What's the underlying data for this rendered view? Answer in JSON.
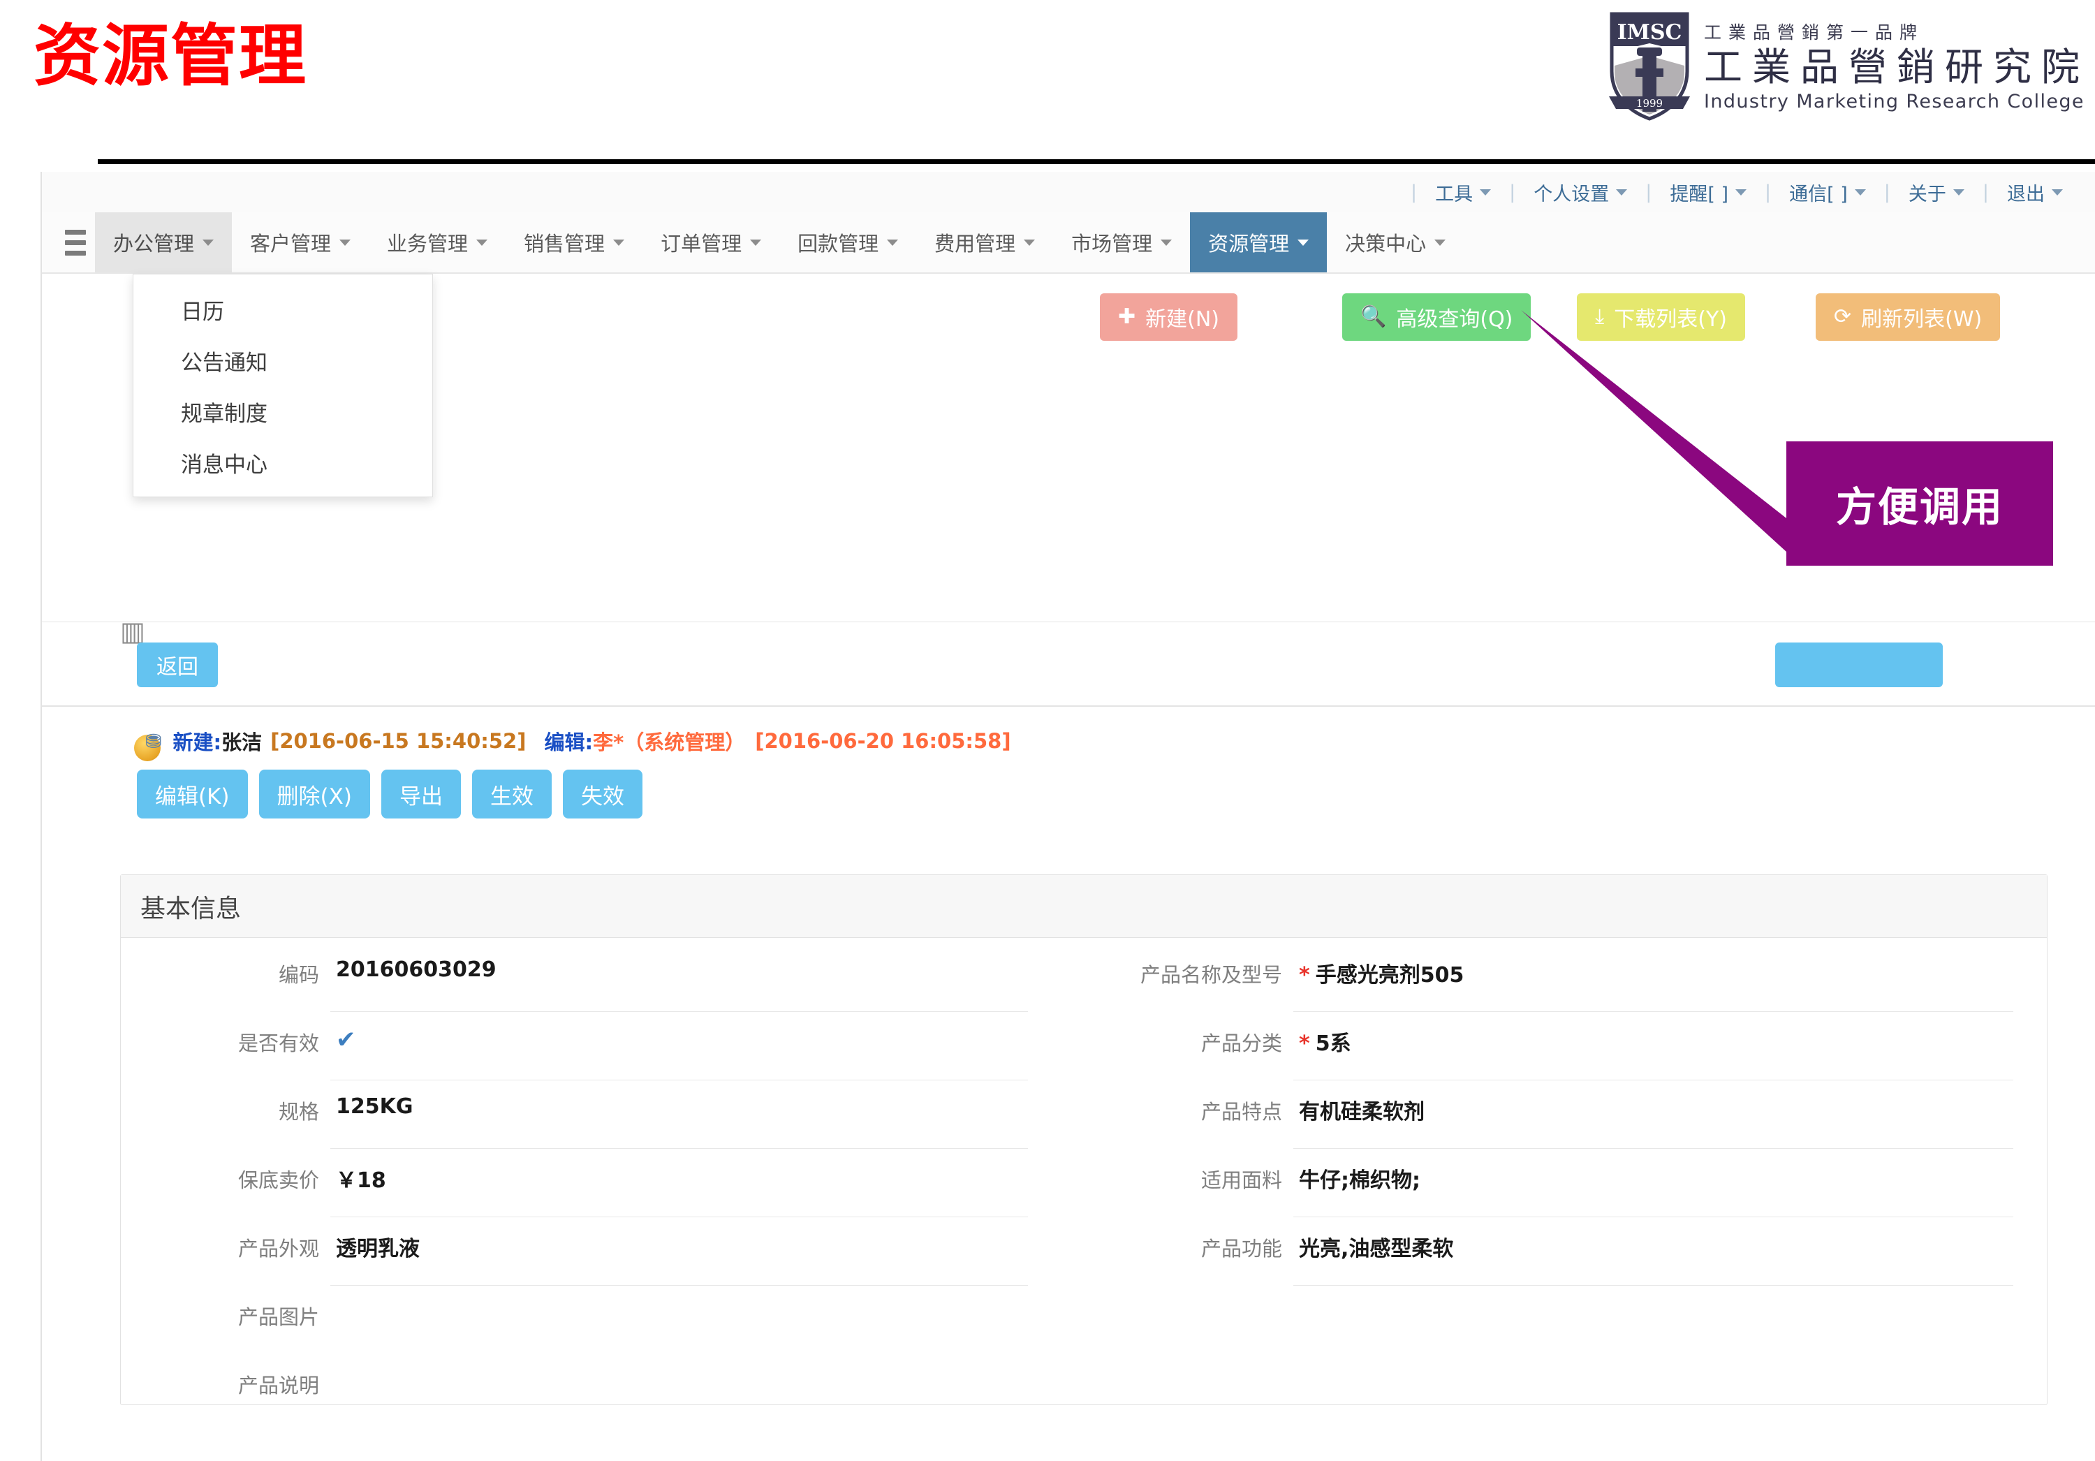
{
  "slide": {
    "title": "资源管理",
    "callout": "方便调用"
  },
  "logo": {
    "shield_text": "IMSC",
    "shield_year": "1999",
    "tagline": "工業品營銷第一品牌",
    "name_cn": "工業品營銷研究院",
    "name_en": "Industry Marketing Research College"
  },
  "utility_bar": {
    "items": [
      {
        "label": "工具",
        "icon": "chevron-down-icon"
      },
      {
        "label": "个人设置",
        "icon": "chevron-down-icon"
      },
      {
        "label": "提醒[ ]",
        "icon": "chevron-down-icon"
      },
      {
        "label": "通信[ ]",
        "icon": "chevron-down-icon"
      },
      {
        "label": "关于",
        "icon": "chevron-down-icon"
      },
      {
        "label": "退出",
        "icon": "chevron-down-icon"
      }
    ]
  },
  "main_nav": {
    "menu_icon": "hamburger-icon",
    "items": [
      {
        "label": "办公管理",
        "state": "open"
      },
      {
        "label": "客户管理",
        "state": "normal"
      },
      {
        "label": "业务管理",
        "state": "normal"
      },
      {
        "label": "销售管理",
        "state": "normal"
      },
      {
        "label": "订单管理",
        "state": "normal"
      },
      {
        "label": "回款管理",
        "state": "normal"
      },
      {
        "label": "费用管理",
        "state": "normal"
      },
      {
        "label": "市场管理",
        "state": "normal"
      },
      {
        "label": "资源管理",
        "state": "active"
      },
      {
        "label": "决策中心",
        "state": "normal"
      }
    ]
  },
  "dropdown": {
    "parent": "办公管理",
    "items": [
      {
        "label": "日历"
      },
      {
        "label": "公告通知"
      },
      {
        "label": "规章制度"
      },
      {
        "label": "消息中心"
      }
    ]
  },
  "toolbar": {
    "new_icon": "plus-icon",
    "new_label": "新建(N)",
    "query_icon": "search-icon",
    "query_label": "高级查询(Q)",
    "download_icon": "download-icon",
    "download_label": "下载列表(Y)",
    "refresh_icon": "refresh-icon",
    "refresh_label": "刷新列表(W)",
    "colors": {
      "new": "#f2a49b",
      "query": "#6ed77f",
      "download": "#e5e86e",
      "refresh": "#f2bd79"
    }
  },
  "record_bar": {
    "back_label": "返回",
    "top_right_label": ""
  },
  "audit": {
    "icon": "record-icon",
    "create_label": "新建:",
    "create_user": "张洁",
    "create_date": "[2016-06-15 15:40:52]",
    "edit_label": "编辑:",
    "edit_user": "李*（系统管理）",
    "edit_date": "[2016-06-20 16:05:58]"
  },
  "record_actions": [
    {
      "label": "编辑(K)"
    },
    {
      "label": "删除(X)"
    },
    {
      "label": "导出"
    },
    {
      "label": "生效"
    },
    {
      "label": "失效"
    }
  ],
  "info_card": {
    "header": "基本信息",
    "left_fields": [
      {
        "label": "编码",
        "value": "20160603029",
        "required": false,
        "type": "text"
      },
      {
        "label": "是否有效",
        "value": "✔",
        "required": false,
        "type": "check"
      },
      {
        "label": "规格",
        "value": "125KG",
        "required": false,
        "type": "text"
      },
      {
        "label": "保底卖价",
        "value": "￥18",
        "required": false,
        "type": "text"
      },
      {
        "label": "产品外观",
        "value": "透明乳液",
        "required": false,
        "type": "text"
      },
      {
        "label": "产品图片",
        "value": "",
        "required": false,
        "type": "empty"
      },
      {
        "label": "产品说明",
        "value": "",
        "required": false,
        "type": "empty"
      }
    ],
    "right_fields": [
      {
        "label": "产品名称及型号",
        "value": "手感光亮剂505",
        "required": true,
        "type": "text"
      },
      {
        "label": "产品分类",
        "value": "5系",
        "required": true,
        "type": "text"
      },
      {
        "label": "产品特点",
        "value": "有机硅柔软剂",
        "required": false,
        "type": "text"
      },
      {
        "label": "适用面料",
        "value": "牛仔;棉织物;",
        "required": false,
        "type": "text"
      },
      {
        "label": "产品功能",
        "value": "光亮,油感型柔软",
        "required": false,
        "type": "text"
      },
      {
        "label": "",
        "value": "",
        "required": false,
        "type": "empty"
      },
      {
        "label": "",
        "value": "",
        "required": false,
        "type": "empty"
      }
    ]
  },
  "colors": {
    "title_red": "#FF0000",
    "callout_purple": "#8B077F",
    "nav_active": "#4a80a8",
    "button_blue": "#64c3f0",
    "required_red": "#e8332a"
  }
}
